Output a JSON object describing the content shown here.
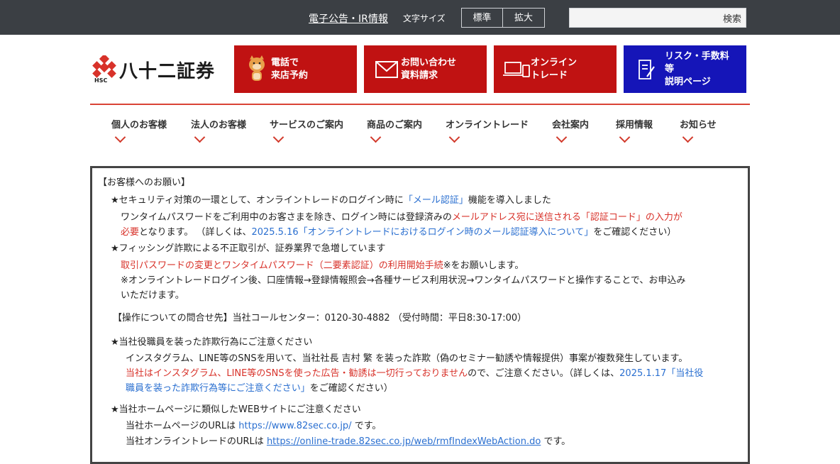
{
  "topbar": {
    "ir_link": "電子公告・IR情報",
    "font_size_label": "文字サイズ",
    "standard": "標準",
    "large": "拡大",
    "search_button": "検索",
    "search_placeholder": ""
  },
  "logo": {
    "text": "八十二証券",
    "sub": "HSC"
  },
  "header_buttons": [
    {
      "label": "電話で\n来店予約",
      "color": "#c01212"
    },
    {
      "label": "お問い合わせ\n資料請求",
      "color": "#c01212"
    },
    {
      "label": "オンライン\nトレード",
      "color": "#c01212"
    },
    {
      "label": "リスク・手数料\n等\n説明ページ",
      "color": "#1515b8"
    }
  ],
  "nav": [
    "個人のお客様",
    "法人のお客様",
    "サービスのご案内",
    "商品のご案内",
    "オンライントレード",
    "会社案内",
    "採用情報",
    "お知らせ"
  ],
  "notice": {
    "title": "【お客様へのお願い】",
    "s1_head_a": "★セキュリティ対策の一環として、オンライントレードのログイン時に",
    "s1_head_link": "「メール認証」",
    "s1_head_b": "機能を導入しました",
    "s1_l1_a": "ワンタイムパスワードをご利用中のお客さまを除き、ログイン時には登録済みの",
    "s1_l1_red": "メールアドレス宛に送信される「認証コード」の入力が",
    "s1_l2_red": "必要",
    "s1_l2_a": "となります。 （詳しくは、",
    "s1_l2_link": "2025.5.16「オンライントレードにおけるログイン時のメール認証導入について」",
    "s1_l2_b": "をご確認ください）",
    "s2_head": "★フィッシング詐欺による不正取引が、証券業界で急増しています",
    "s2_l1_red": "取引パスワードの変更とワンタイムパスワード（二要素認証）の利用開始手続",
    "s2_l1_b": "※をお願いします。",
    "s2_l2": "※オンライントレードログイン後、口座情報→登録情報照会→各種サービス利用状況→ワンタイムパスワードと操作することで、お申込み",
    "s2_l3": "いただけます。",
    "contact": "【操作についての問合せ先】当社コールセンター：0120-30-4882 （受付時間：平日8:30-17:00）",
    "s3_head": "★当社役職員を装った詐欺行為にご注意ください",
    "s3_l1": "インスタグラム、LINE等のSNSを用いて、当社社長 吉村 繁 を装った詐欺（偽のセミナー勧誘や情報提供）事案が複数発生しています。",
    "s3_l2_red": "当社はインスタグラム、LINE等のSNSを使った広告・勧誘は一切行っておりません",
    "s3_l2_a": "ので、ご注意ください。（詳しくは、",
    "s3_l2_link": "2025.1.17「当社役",
    "s3_l3_link": "職員を装った詐欺行為等にご注意ください」",
    "s3_l3_b": "をご確認ください）",
    "s4_head": "★当社ホームページに類似したWEBサイトにご注意ください",
    "s4_l1_a": "当社ホームページのURLは ",
    "s4_l1_link": "https://www.82sec.co.jp/",
    "s4_l1_b": " です。",
    "s4_l2_a": "当社オンライントレードのURLは ",
    "s4_l2_link": "https://online-trade.82sec.co.jp/web/rmfIndexWebAction.do",
    "s4_l2_b": " です。"
  }
}
